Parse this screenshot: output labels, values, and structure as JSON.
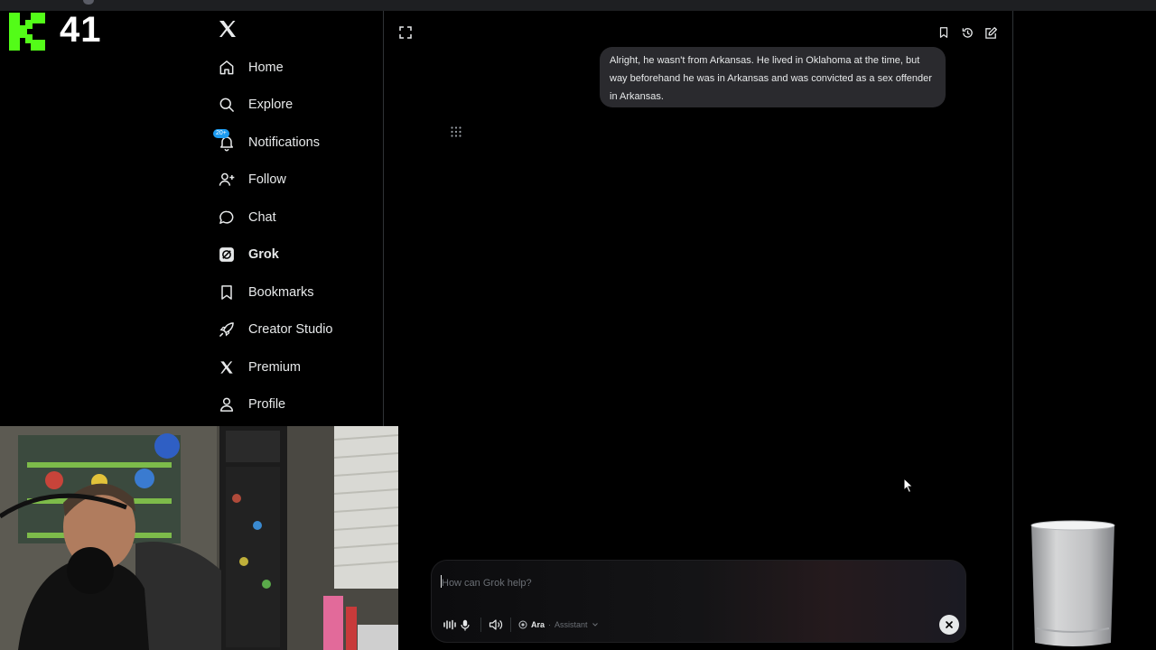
{
  "overlay": {
    "viewer_count": "41",
    "kick_logo_color": "#53fc18"
  },
  "sidebar": {
    "logo": "x-logo-icon",
    "items": [
      {
        "label": "Home",
        "icon": "home-icon"
      },
      {
        "label": "Explore",
        "icon": "search-icon"
      },
      {
        "label": "Notifications",
        "icon": "bell-icon",
        "badge": "20+"
      },
      {
        "label": "Follow",
        "icon": "person-add-icon"
      },
      {
        "label": "Chat",
        "icon": "chat-bubble-icon"
      },
      {
        "label": "Grok",
        "icon": "grok-icon",
        "active": true
      },
      {
        "label": "Bookmarks",
        "icon": "bookmark-icon"
      },
      {
        "label": "Creator Studio",
        "icon": "rocket-icon"
      },
      {
        "label": "Premium",
        "icon": "x-premium-icon"
      },
      {
        "label": "Profile",
        "icon": "person-icon"
      }
    ]
  },
  "conversation": {
    "user_message": "Alright, he wasn't from Arkansas. He lived in Oklahoma at the time, but way beforehand he was in Arkansas and was convicted as a sex offender in Arkansas."
  },
  "composer": {
    "placeholder": "How can Grok help?",
    "value": "",
    "voice": "Ara",
    "mode": "Assistant"
  },
  "colors": {
    "background": "#000000",
    "text": "#e7e9ea",
    "bubble": "#2a2a2e",
    "notification_badge": "#1d9bf0"
  }
}
